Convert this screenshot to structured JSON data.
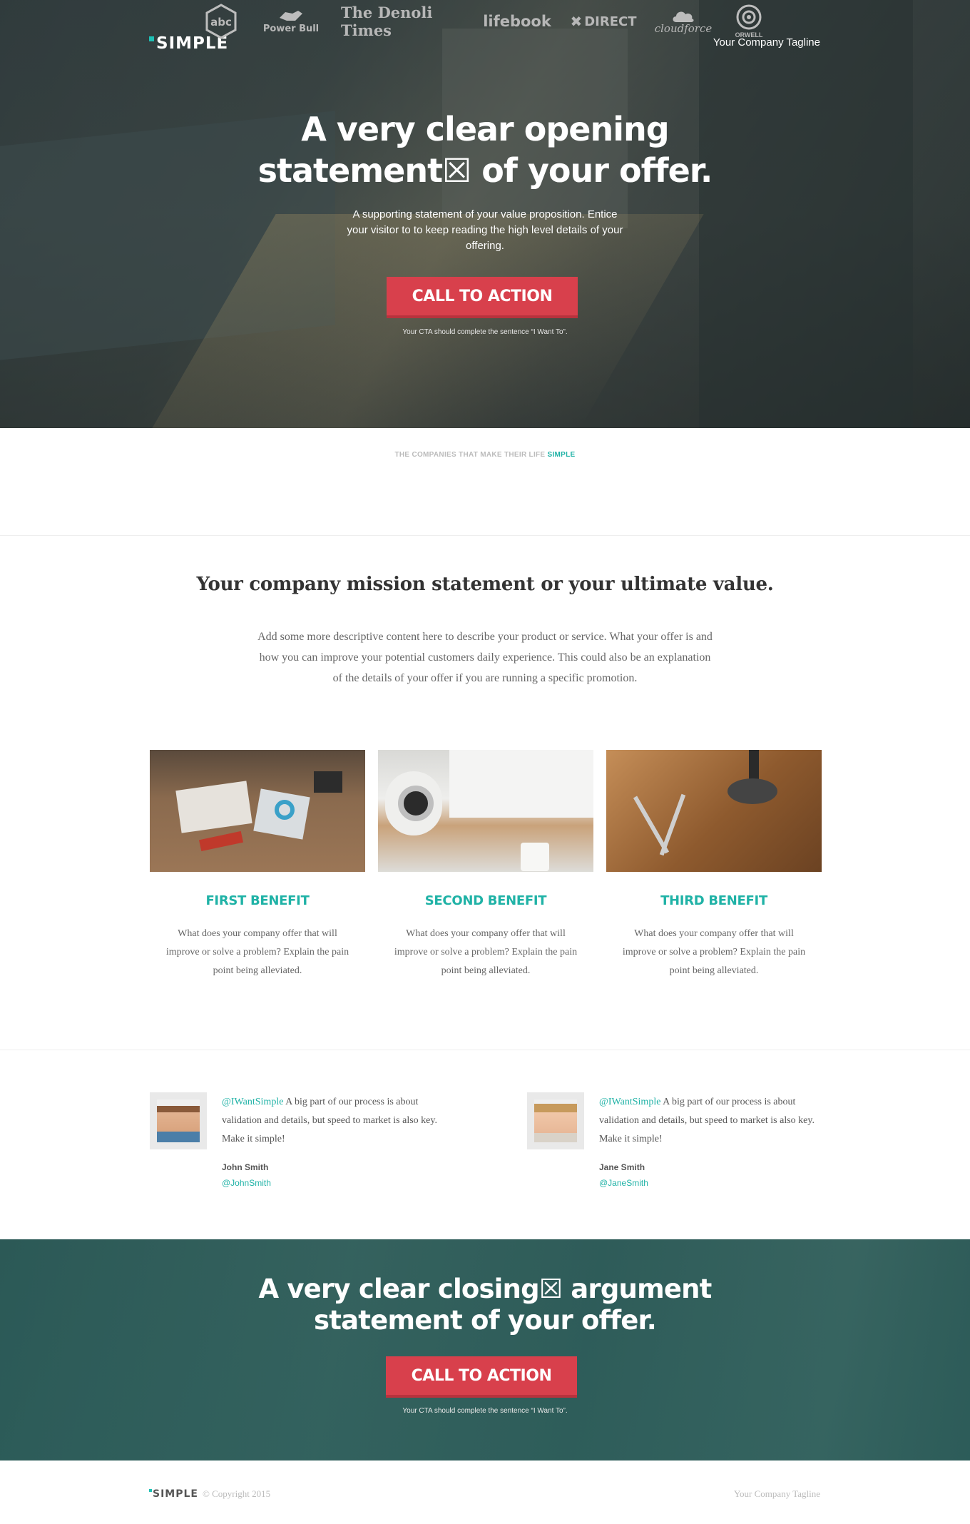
{
  "brand": {
    "name": "SIMPLE",
    "accent": "#1fc0b5",
    "cta_color": "#d8404c"
  },
  "hero": {
    "tagline": "Your Company Tagline",
    "title_line1": "A very clear opening",
    "title_line2": "statement☒ of your offer.",
    "subtitle": "A supporting statement of your value proposition. Entice your visitor to to keep reading the high level details of your offering.",
    "cta_label": "CALL TO ACTION",
    "cta_note": "Your CTA should complete the sentence “I Want To”."
  },
  "companies": {
    "heading_prefix": "THE COMPANIES THAT MAKE THEIR LIFE ",
    "heading_accent": "SIMPLE",
    "logos": [
      {
        "label": "abc",
        "icon": "abc-hexagon-icon"
      },
      {
        "label": "Power Bull",
        "icon": "bull-icon"
      },
      {
        "label": "The Denoli Times",
        "icon": ""
      },
      {
        "label": "lifebook",
        "icon": ""
      },
      {
        "label": "DIRECT",
        "icon": "x-mark-icon"
      },
      {
        "label": "cloudforce",
        "icon": "cloud-icon"
      },
      {
        "label": "ORWELL",
        "icon": "eye-icon"
      }
    ]
  },
  "mission": {
    "title": "Your company mission statement or your ultimate value.",
    "body": "Add some more descriptive content here to describe your product or service. What your offer is and how you can improve your potential customers daily experience. This could also be an explanation of the details of your offer if you are running a specific promotion."
  },
  "benefits": [
    {
      "title": "FIRST BENEFIT",
      "text": "What does your company offer that will improve or solve a problem? Explain the pain point being alleviated."
    },
    {
      "title": "SECOND BENEFIT",
      "text": "What does your company offer that will improve or solve a problem? Explain the pain point being alleviated."
    },
    {
      "title": "THIRD BENEFIT",
      "text": "What does your company offer that will improve or solve a problem? Explain the pain point being alleviated."
    }
  ],
  "testimonials": [
    {
      "handle": "@IWantSimple",
      "quote": " A big part of our process is about validation and details, but speed to market is also key. Make it simple!",
      "name": "John Smith",
      "user": "@JohnSmith"
    },
    {
      "handle": "@IWantSimple",
      "quote": " A big part of our process is about validation and details, but speed to market is also key. Make it simple!",
      "name": "Jane Smith",
      "user": "@JaneSmith"
    }
  ],
  "closing": {
    "title_line1": "A very clear closing☒ argument",
    "title_line2": "statement of your offer.",
    "cta_label": "CALL TO ACTION",
    "cta_note": "Your CTA should complete the sentence “I Want To”."
  },
  "footer": {
    "brand": "SIMPLE",
    "copyright": "© Copyright 2015",
    "tagline": "Your Company Tagline"
  }
}
